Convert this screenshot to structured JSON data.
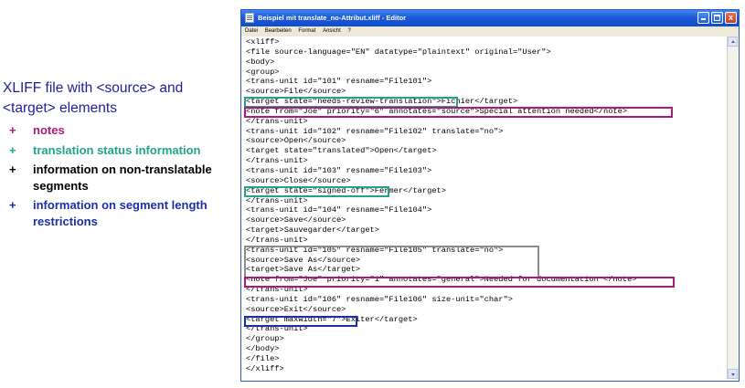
{
  "slide": {
    "title_line1": "XLIFF file with <source> and",
    "title_line2": "<target> elements",
    "bullets": [
      {
        "plus": "+",
        "text": "notes",
        "color": "#b0197a"
      },
      {
        "plus": "+",
        "text": "translation status information",
        "color": "#1fa58a"
      },
      {
        "plus": "+",
        "text": "information on non-translatable segments",
        "color": "#000000"
      },
      {
        "plus": "+",
        "text": "information on segment length restrictions",
        "color": "#1c2fa8"
      }
    ]
  },
  "window": {
    "title": "Beispiel mit translate_no-Attribut.xliff - Editor",
    "icon": "notepad-icon",
    "controls": {
      "minimize": "minimize-icon",
      "maximize": "maximize-icon",
      "close": "close-icon",
      "close_glyph": "x"
    },
    "menu": [
      "Datei",
      "Bearbeiten",
      "Format",
      "Ansicht",
      "?"
    ]
  },
  "code_lines": [
    "<xliff>",
    "<file source-language=\"EN\" datatype=\"plaintext\" original=\"User\">",
    "<body>",
    "<group>",
    "<trans-unit id=\"101\" resname=\"File101\">",
    "<source>File</source>",
    "<target state=\"needs-review-translation\">Fichier</target>",
    "<note from=\"Joe\" priority=\"6\" annotates=\"source\">Special attention needed</note>",
    "</trans-unit>",
    "<trans-unit id=\"102\" resname=\"File102\" translate=\"no\">",
    "<source>Open</source>",
    "<target state=\"translated\">Open</target>",
    "</trans-unit>",
    "<trans-unit id=\"103\" resname=\"File103\">",
    "<source>Close</source>",
    "<target state=\"signed-off\">Fermer</target>",
    "</trans-unit>",
    "<trans-unit id=\"104\" resname=\"File104\">",
    "<source>Save</source>",
    "<target>Sauvegarder</target>",
    "</trans-unit>",
    "<trans-unit id=\"105\" resname=\"File105\" translate=\"no\">",
    "<source>Save As</source>",
    "<target>Save As</target>",
    "<note from=\"Joe\" priority=\"1\" annotates=\"general\">Needed for documentation </note>",
    "</trans-unit>",
    "<trans-unit id=\"106\" resname=\"File106\" size-unit=\"char\">",
    "<source>Exit</source>",
    "<target maxwidth=\"7\">Exiter</target>",
    "</trans-unit>",
    "</group>",
    "</body>",
    "</file>",
    "</xliff>"
  ],
  "colors": {
    "notes": "#b0197a",
    "status": "#1fa58a",
    "non_translatable": "#8c8c8c",
    "length": "#1c2fa8",
    "title_text": "#1f1f9a"
  }
}
